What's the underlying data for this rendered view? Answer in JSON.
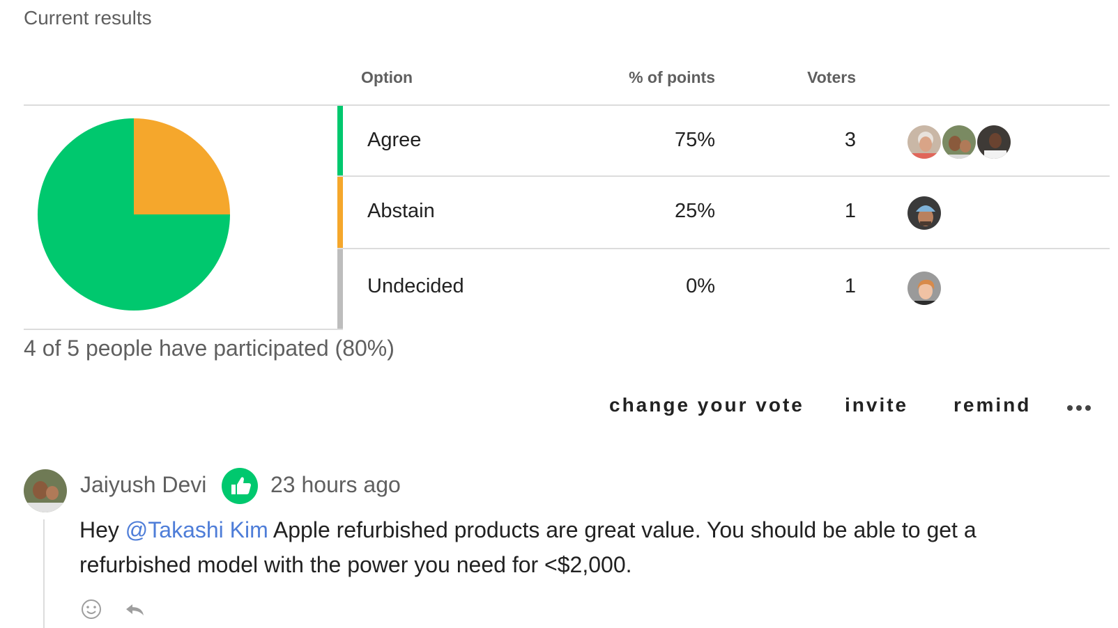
{
  "section_title": "Current results",
  "table": {
    "headers": {
      "option": "Option",
      "points": "% of points",
      "voters": "Voters"
    },
    "rows": [
      {
        "option": "Agree",
        "percent": "75%",
        "voters": "3",
        "color": "#00c86e",
        "voter_avatars": [
          "elderly-woman-avatar",
          "man-with-child-avatar",
          "woman-avatar"
        ]
      },
      {
        "option": "Abstain",
        "percent": "25%",
        "voters": "1",
        "color": "#f5a72c",
        "voter_avatars": [
          "man-with-beanie-avatar"
        ]
      },
      {
        "option": "Undecided",
        "percent": "0%",
        "voters": "1",
        "color": "#bdbdbd",
        "voter_avatars": [
          "woman-short-hair-avatar"
        ]
      }
    ]
  },
  "chart_data": {
    "type": "pie",
    "categories": [
      "Agree",
      "Abstain",
      "Undecided"
    ],
    "values": [
      75,
      25,
      0
    ],
    "colors": [
      "#00c86e",
      "#f5a72c",
      "#bdbdbd"
    ]
  },
  "participation": "4 of 5 people have participated (80%)",
  "actions": {
    "change_vote": "change your vote",
    "invite": "invite",
    "remind": "remind",
    "more_icon": "more-horizontal-icon"
  },
  "comment": {
    "author": "Jaiyush Devi",
    "stance_icon": "thumbs-up-icon",
    "time": "23 hours ago",
    "body_prefix": "Hey ",
    "mention": "@Takashi Kim",
    "body_suffix": " Apple refurbished products are great value. You should be able to get a refurbished model with the power you need for <$2,000.",
    "react_icon": "smiley-icon",
    "reply_icon": "reply-icon"
  },
  "colors": {
    "agree": "#00c86e",
    "abstain": "#f5a72c",
    "undecided": "#bdbdbd",
    "mention": "#4e7dd8"
  }
}
